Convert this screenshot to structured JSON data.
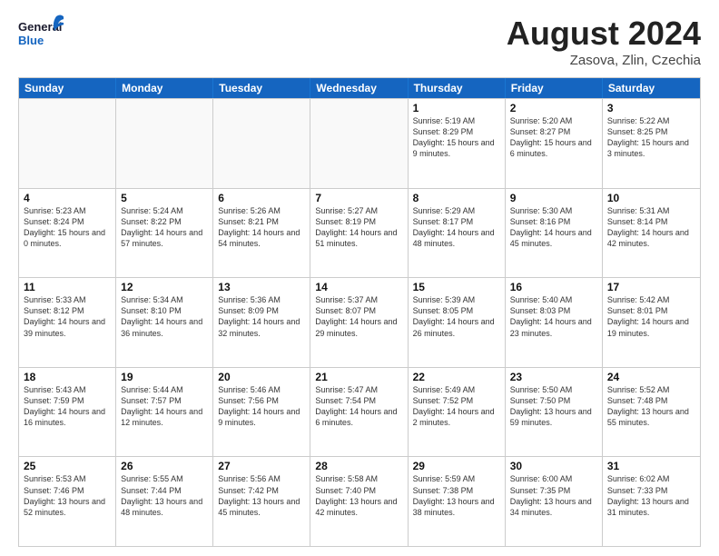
{
  "logo": {
    "line1": "General",
    "line2": "Blue"
  },
  "title": "August 2024",
  "subtitle": "Zasova, Zlin, Czechia",
  "days": [
    "Sunday",
    "Monday",
    "Tuesday",
    "Wednesday",
    "Thursday",
    "Friday",
    "Saturday"
  ],
  "rows": [
    [
      {
        "num": "",
        "text": "",
        "empty": true
      },
      {
        "num": "",
        "text": "",
        "empty": true
      },
      {
        "num": "",
        "text": "",
        "empty": true
      },
      {
        "num": "",
        "text": "",
        "empty": true
      },
      {
        "num": "1",
        "text": "Sunrise: 5:19 AM\nSunset: 8:29 PM\nDaylight: 15 hours\nand 9 minutes."
      },
      {
        "num": "2",
        "text": "Sunrise: 5:20 AM\nSunset: 8:27 PM\nDaylight: 15 hours\nand 6 minutes."
      },
      {
        "num": "3",
        "text": "Sunrise: 5:22 AM\nSunset: 8:25 PM\nDaylight: 15 hours\nand 3 minutes."
      }
    ],
    [
      {
        "num": "4",
        "text": "Sunrise: 5:23 AM\nSunset: 8:24 PM\nDaylight: 15 hours\nand 0 minutes."
      },
      {
        "num": "5",
        "text": "Sunrise: 5:24 AM\nSunset: 8:22 PM\nDaylight: 14 hours\nand 57 minutes."
      },
      {
        "num": "6",
        "text": "Sunrise: 5:26 AM\nSunset: 8:21 PM\nDaylight: 14 hours\nand 54 minutes."
      },
      {
        "num": "7",
        "text": "Sunrise: 5:27 AM\nSunset: 8:19 PM\nDaylight: 14 hours\nand 51 minutes."
      },
      {
        "num": "8",
        "text": "Sunrise: 5:29 AM\nSunset: 8:17 PM\nDaylight: 14 hours\nand 48 minutes."
      },
      {
        "num": "9",
        "text": "Sunrise: 5:30 AM\nSunset: 8:16 PM\nDaylight: 14 hours\nand 45 minutes."
      },
      {
        "num": "10",
        "text": "Sunrise: 5:31 AM\nSunset: 8:14 PM\nDaylight: 14 hours\nand 42 minutes."
      }
    ],
    [
      {
        "num": "11",
        "text": "Sunrise: 5:33 AM\nSunset: 8:12 PM\nDaylight: 14 hours\nand 39 minutes."
      },
      {
        "num": "12",
        "text": "Sunrise: 5:34 AM\nSunset: 8:10 PM\nDaylight: 14 hours\nand 36 minutes."
      },
      {
        "num": "13",
        "text": "Sunrise: 5:36 AM\nSunset: 8:09 PM\nDaylight: 14 hours\nand 32 minutes."
      },
      {
        "num": "14",
        "text": "Sunrise: 5:37 AM\nSunset: 8:07 PM\nDaylight: 14 hours\nand 29 minutes."
      },
      {
        "num": "15",
        "text": "Sunrise: 5:39 AM\nSunset: 8:05 PM\nDaylight: 14 hours\nand 26 minutes."
      },
      {
        "num": "16",
        "text": "Sunrise: 5:40 AM\nSunset: 8:03 PM\nDaylight: 14 hours\nand 23 minutes."
      },
      {
        "num": "17",
        "text": "Sunrise: 5:42 AM\nSunset: 8:01 PM\nDaylight: 14 hours\nand 19 minutes."
      }
    ],
    [
      {
        "num": "18",
        "text": "Sunrise: 5:43 AM\nSunset: 7:59 PM\nDaylight: 14 hours\nand 16 minutes."
      },
      {
        "num": "19",
        "text": "Sunrise: 5:44 AM\nSunset: 7:57 PM\nDaylight: 14 hours\nand 12 minutes."
      },
      {
        "num": "20",
        "text": "Sunrise: 5:46 AM\nSunset: 7:56 PM\nDaylight: 14 hours\nand 9 minutes."
      },
      {
        "num": "21",
        "text": "Sunrise: 5:47 AM\nSunset: 7:54 PM\nDaylight: 14 hours\nand 6 minutes."
      },
      {
        "num": "22",
        "text": "Sunrise: 5:49 AM\nSunset: 7:52 PM\nDaylight: 14 hours\nand 2 minutes."
      },
      {
        "num": "23",
        "text": "Sunrise: 5:50 AM\nSunset: 7:50 PM\nDaylight: 13 hours\nand 59 minutes."
      },
      {
        "num": "24",
        "text": "Sunrise: 5:52 AM\nSunset: 7:48 PM\nDaylight: 13 hours\nand 55 minutes."
      }
    ],
    [
      {
        "num": "25",
        "text": "Sunrise: 5:53 AM\nSunset: 7:46 PM\nDaylight: 13 hours\nand 52 minutes."
      },
      {
        "num": "26",
        "text": "Sunrise: 5:55 AM\nSunset: 7:44 PM\nDaylight: 13 hours\nand 48 minutes."
      },
      {
        "num": "27",
        "text": "Sunrise: 5:56 AM\nSunset: 7:42 PM\nDaylight: 13 hours\nand 45 minutes."
      },
      {
        "num": "28",
        "text": "Sunrise: 5:58 AM\nSunset: 7:40 PM\nDaylight: 13 hours\nand 42 minutes."
      },
      {
        "num": "29",
        "text": "Sunrise: 5:59 AM\nSunset: 7:38 PM\nDaylight: 13 hours\nand 38 minutes."
      },
      {
        "num": "30",
        "text": "Sunrise: 6:00 AM\nSunset: 7:35 PM\nDaylight: 13 hours\nand 34 minutes."
      },
      {
        "num": "31",
        "text": "Sunrise: 6:02 AM\nSunset: 7:33 PM\nDaylight: 13 hours\nand 31 minutes."
      }
    ]
  ]
}
